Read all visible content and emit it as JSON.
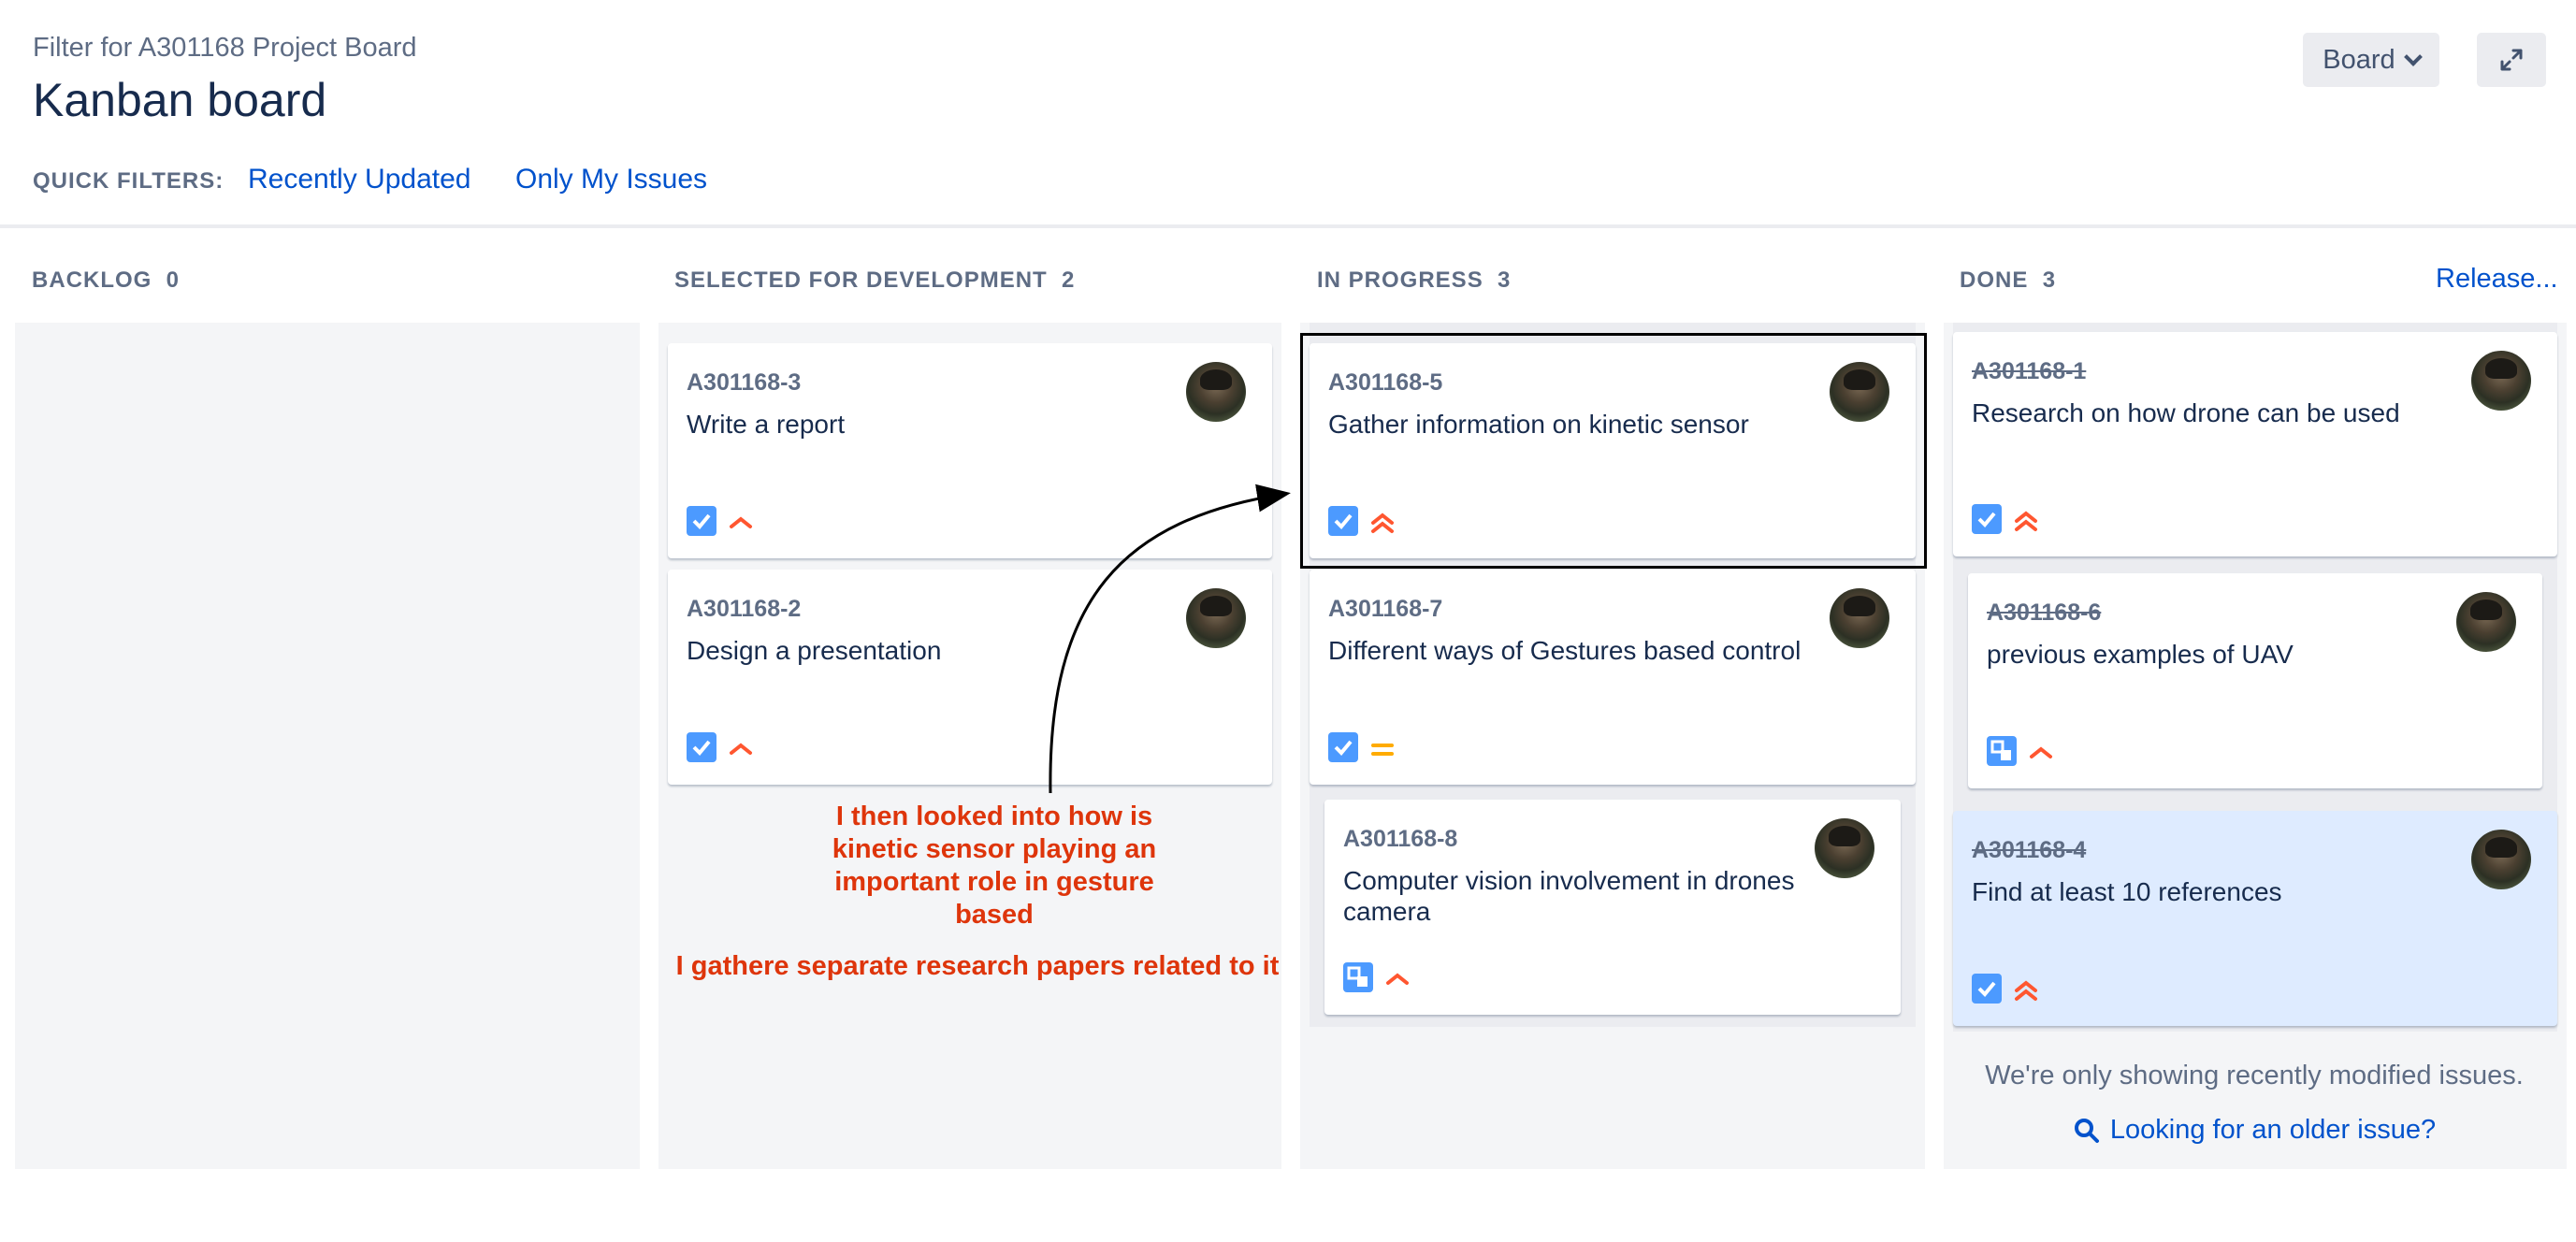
{
  "header": {
    "subtitle": "Filter for A301168 Project Board",
    "title": "Kanban board",
    "board_button": "Board",
    "board_chevron_icon": "chevron-down-icon",
    "expand_icon": "expand-icon"
  },
  "quick_filters": {
    "label": "QUICK FILTERS:",
    "items": [
      "Recently Updated",
      "Only My Issues"
    ]
  },
  "columns": [
    {
      "name": "BACKLOG",
      "count": "0"
    },
    {
      "name": "SELECTED FOR DEVELOPMENT",
      "count": "2"
    },
    {
      "name": "IN PROGRESS",
      "count": "3"
    },
    {
      "name": "DONE",
      "count": "3"
    }
  ],
  "release_label": "Release...",
  "cards": {
    "selected": [
      {
        "key": "A301168-3",
        "summary": "Write a report",
        "type": "task-icon",
        "priority": "high-priority-icon"
      },
      {
        "key": "A301168-2",
        "summary": "Design a presentation",
        "type": "task-icon",
        "priority": "high-priority-icon"
      }
    ],
    "in_progress": [
      {
        "key": "A301168-5",
        "summary": "Gather information on kinetic sensor",
        "type": "task-icon",
        "priority": "highest-priority-icon"
      },
      {
        "key": "A301168-7",
        "summary": "Different ways of Gestures based control",
        "type": "task-icon",
        "priority": "medium-priority-icon"
      },
      {
        "key": "A301168-8",
        "summary": "Computer vision involvement in drones camera",
        "type": "subtask-icon",
        "priority": "high-priority-icon"
      }
    ],
    "done": [
      {
        "key": "A301168-1",
        "summary": "Research on how drone can be used",
        "type": "task-icon",
        "priority": "highest-priority-icon"
      },
      {
        "key": "A301168-6",
        "summary": "previous examples of UAV",
        "type": "subtask-icon",
        "priority": "high-priority-icon"
      },
      {
        "key": "A301168-4",
        "summary": "Find at least 10 references",
        "type": "task-icon",
        "priority": "highest-priority-icon"
      }
    ]
  },
  "done_footer": {
    "message": "We're only showing recently modified issues.",
    "link": "Looking for an older issue?",
    "link_icon": "search-icon"
  },
  "annotations": {
    "note_1": "I then looked into how is kinetic sensor playing an important role in gesture based",
    "note_2": "I gathere separate research papers related to it",
    "colors": {
      "annotation_red": "#de350b"
    }
  }
}
